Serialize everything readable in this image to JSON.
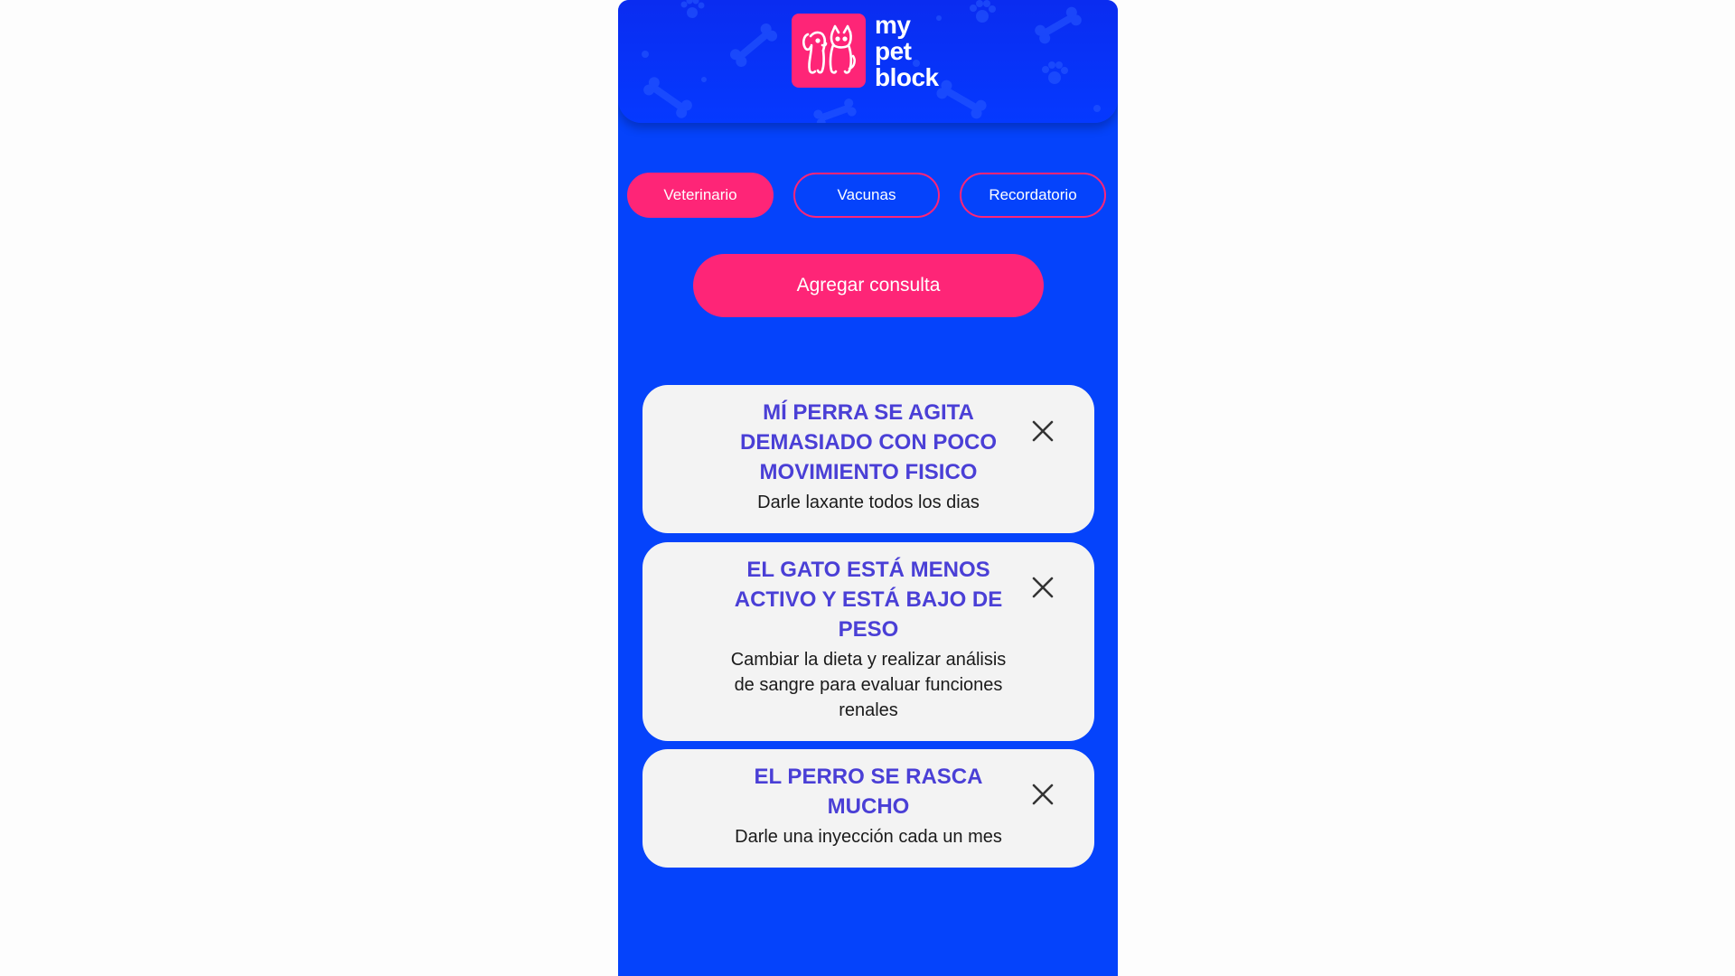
{
  "app": {
    "logo_lines": [
      "my",
      "pet",
      "block"
    ],
    "accent_color": "#fe2577",
    "background_color": "#0543fb"
  },
  "tabs": [
    {
      "label": "Veterinario",
      "active": true
    },
    {
      "label": "Vacunas",
      "active": false
    },
    {
      "label": "Recordatorio",
      "active": false
    }
  ],
  "add_button_label": "Agregar consulta",
  "consultations": [
    {
      "title": "MÍ PERRA SE AGITA DEMASIADO CON POCO MOVIMIENTO FISICO",
      "description": "Darle laxante todos los dias"
    },
    {
      "title": "EL GATO ESTÁ MENOS ACTIVO Y ESTÁ BAJO DE PESO",
      "description": "Cambiar la dieta y realizar análisis de sangre para evaluar funciones renales"
    },
    {
      "title": "EL PERRO SE RASCA MUCHO",
      "description": "Darle una inyección cada un mes"
    }
  ],
  "icons": {
    "close": "close-icon",
    "logo": "dog-cat-logo-icon"
  }
}
